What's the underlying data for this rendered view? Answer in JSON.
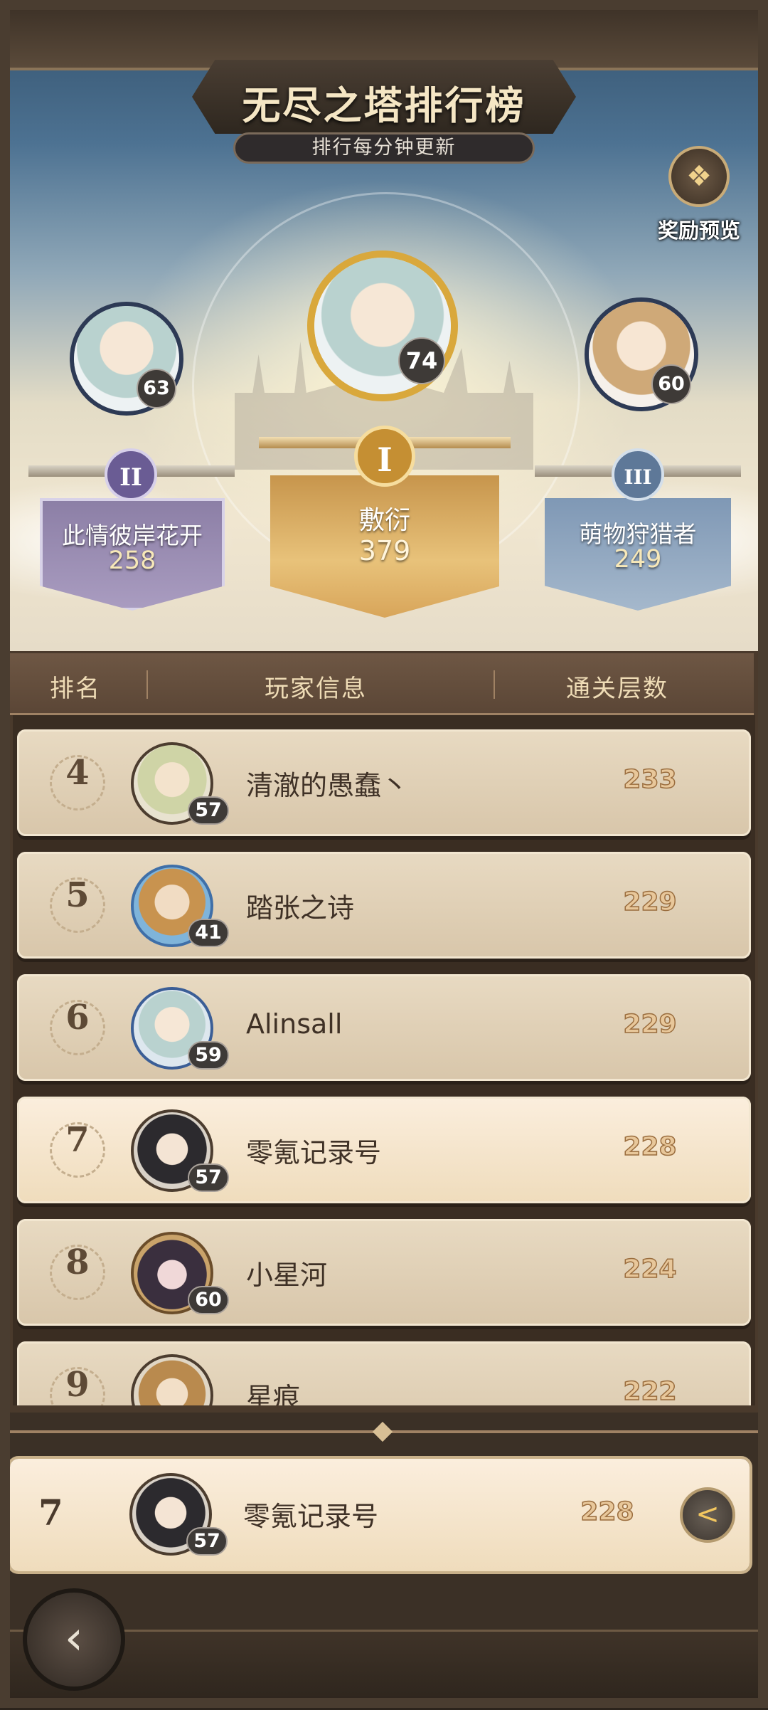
{
  "header": {
    "title": "无尽之塔排行榜",
    "subtitle": "排行每分钟更新",
    "reward_button": {
      "label": "奖励预览",
      "icon": "treasure-chest-icon"
    }
  },
  "podium": {
    "first": {
      "rank_mark": "I",
      "name": "敷衍",
      "score": "379",
      "level": "74",
      "color": "#d9a85a"
    },
    "second": {
      "rank_mark": "II",
      "name": "此情彼岸花开",
      "score": "258",
      "level": "63",
      "color": "#9d8fbd"
    },
    "third": {
      "rank_mark": "III",
      "name": "萌物狩猎者",
      "score": "249",
      "level": "60",
      "color": "#8ea6c2"
    }
  },
  "list": {
    "columns": [
      "排名",
      "玩家信息",
      "通关层数"
    ],
    "rows": [
      {
        "rank": "4",
        "name": "清澈的愚蠢丶",
        "level": "57",
        "score": "233"
      },
      {
        "rank": "5",
        "name": "踏张之诗",
        "level": "41",
        "score": "229"
      },
      {
        "rank": "6",
        "name": "Alinsall",
        "level": "59",
        "score": "229"
      },
      {
        "rank": "7",
        "name": "零氪记录号",
        "level": "57",
        "score": "228"
      },
      {
        "rank": "8",
        "name": "小星河",
        "level": "60",
        "score": "224"
      },
      {
        "rank": "9",
        "name": "星痕",
        "level": "",
        "score": "222"
      }
    ]
  },
  "me": {
    "rank": "7",
    "name": "零氪记录号",
    "level": "57",
    "score": "228",
    "share_icon": "share-icon"
  },
  "nav": {
    "back_icon": "back-arrow-icon"
  }
}
